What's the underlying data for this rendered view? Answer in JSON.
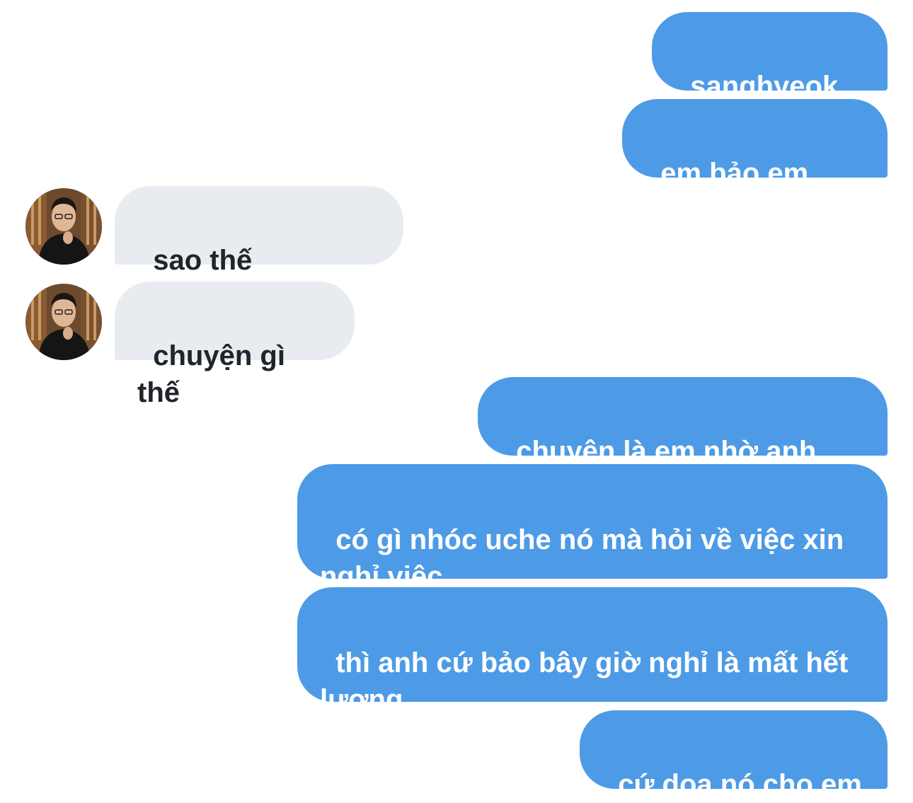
{
  "conversation": {
    "messages": [
      {
        "sender": "me",
        "text": "sanghyeok ơi"
      },
      {
        "sender": "me",
        "text": "em bảo em bảo"
      },
      {
        "sender": "other",
        "text": "sao thế wangho?"
      },
      {
        "sender": "other",
        "text": "chuyện gì thế"
      },
      {
        "sender": "me",
        "text": "chuyện là em nhờ anh xíu"
      },
      {
        "sender": "me",
        "text": "có gì nhóc uche nó mà hỏi về việc xin\nnghỉ việc"
      },
      {
        "sender": "me",
        "text": "thì anh cứ bảo bây giờ nghỉ là mất hết\nlương"
      },
      {
        "sender": "me",
        "text": "cứ doạ nó cho em"
      }
    ]
  },
  "colors": {
    "outgoing_bubble": "#4d9be6",
    "incoming_bubble": "#e8ecf0",
    "outgoing_text": "#ffffff",
    "incoming_text": "#212529"
  },
  "icons": {
    "avatar": "avatar-icon"
  }
}
